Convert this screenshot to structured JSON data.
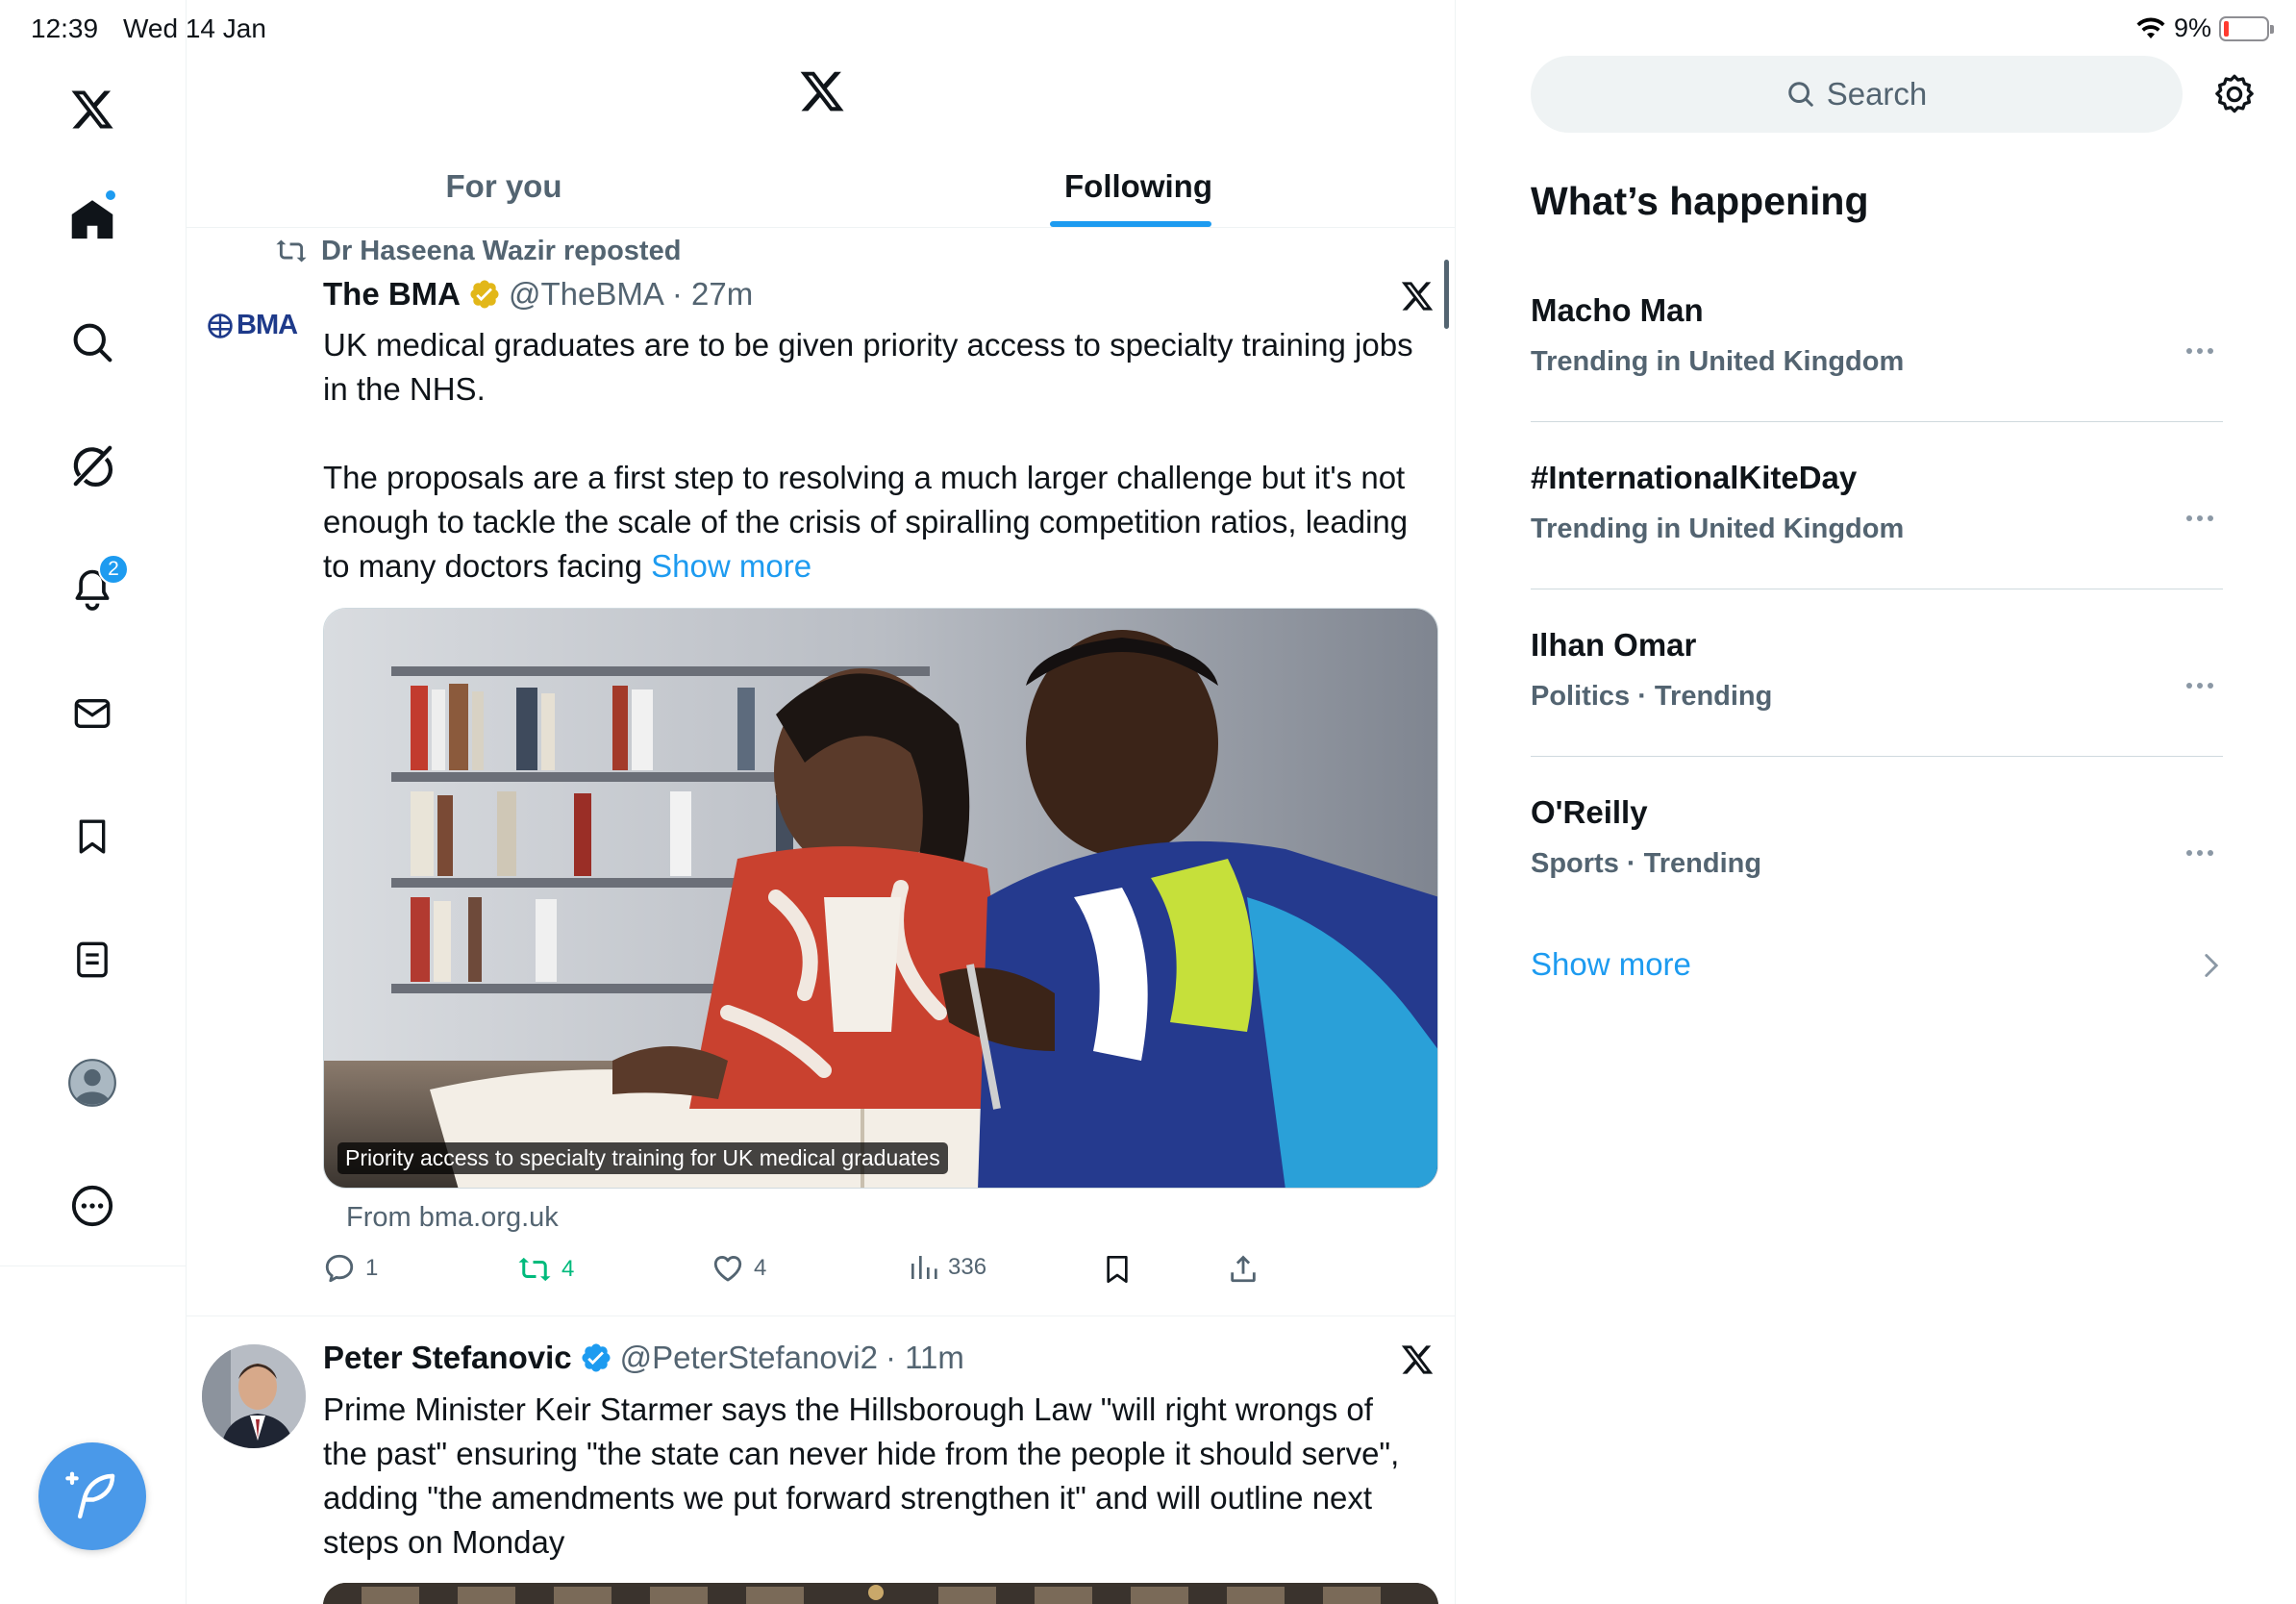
{
  "status_bar": {
    "time": "12:39",
    "date": "Wed 14 Jan",
    "battery": "9%",
    "battery_color": "#ff3b30"
  },
  "nav": {
    "items": [
      {
        "name": "home",
        "icon": "home-icon",
        "active": true,
        "dot": true
      },
      {
        "name": "explore",
        "icon": "search-icon"
      },
      {
        "name": "grok",
        "icon": "grok-icon"
      },
      {
        "name": "notifications",
        "icon": "bell-icon",
        "badge": "2"
      },
      {
        "name": "messages",
        "icon": "envelope-icon"
      },
      {
        "name": "bookmarks",
        "icon": "bookmark-icon"
      },
      {
        "name": "lists",
        "icon": "list-icon"
      },
      {
        "name": "profile",
        "icon": "avatar-icon"
      },
      {
        "name": "more",
        "icon": "more-circle-icon"
      }
    ],
    "compose_icon": "compose-feather-icon"
  },
  "header": {
    "logo": "x-logo-icon",
    "tabs": [
      {
        "label": "For you",
        "active": false
      },
      {
        "label": "Following",
        "active": true
      }
    ]
  },
  "feed": {
    "posts": [
      {
        "repost_by": "Dr Haseena Wazir reposted",
        "avatar_text": "BMA",
        "author": "The BMA",
        "verified": "gold",
        "handle": "@TheBMA",
        "time": "· 27m",
        "text": "UK medical graduates are to be given priority access to specialty training jobs in the NHS.\n\nThe proposals are a first step to resolving a much larger challenge but it's not enough to tackle the scale of the crisis of spiralling competition ratios, leading to many doctors facing",
        "show_more": "Show more",
        "card_caption": "Priority access to specialty training for UK medical graduates",
        "card_source": "From bma.org.uk",
        "replies": "1",
        "reposts": "4",
        "likes": "4",
        "views": "336"
      },
      {
        "author": "Peter Stefanovic",
        "verified": "blue",
        "handle": "@PeterStefanovi2",
        "time": "· 11m",
        "text": "Prime Minister Keir Starmer says the Hillsborough Law \"will right wrongs of the past\" ensuring \"the state can never hide from the people it should serve\", adding \"the amendments we put forward strengthen it\" and will outline next steps on Monday"
      }
    ]
  },
  "sidebar": {
    "search_placeholder": "Search",
    "section_title": "What’s happening",
    "trends": [
      {
        "name": "Macho Man",
        "meta": "Trending in United Kingdom"
      },
      {
        "name": "#InternationalKiteDay",
        "meta": "Trending in United Kingdom"
      },
      {
        "name": "Ilhan Omar",
        "meta": "Politics · Trending"
      },
      {
        "name": "O'Reilly",
        "meta": "Sports · Trending"
      }
    ],
    "show_more": "Show more"
  },
  "colors": {
    "accent": "#1d9bf0",
    "text": "#0f1419",
    "muted": "#536471",
    "repost_green": "#00ba7c",
    "verified_gold": "#e2b719",
    "compose_fab": "#4a99e9"
  }
}
